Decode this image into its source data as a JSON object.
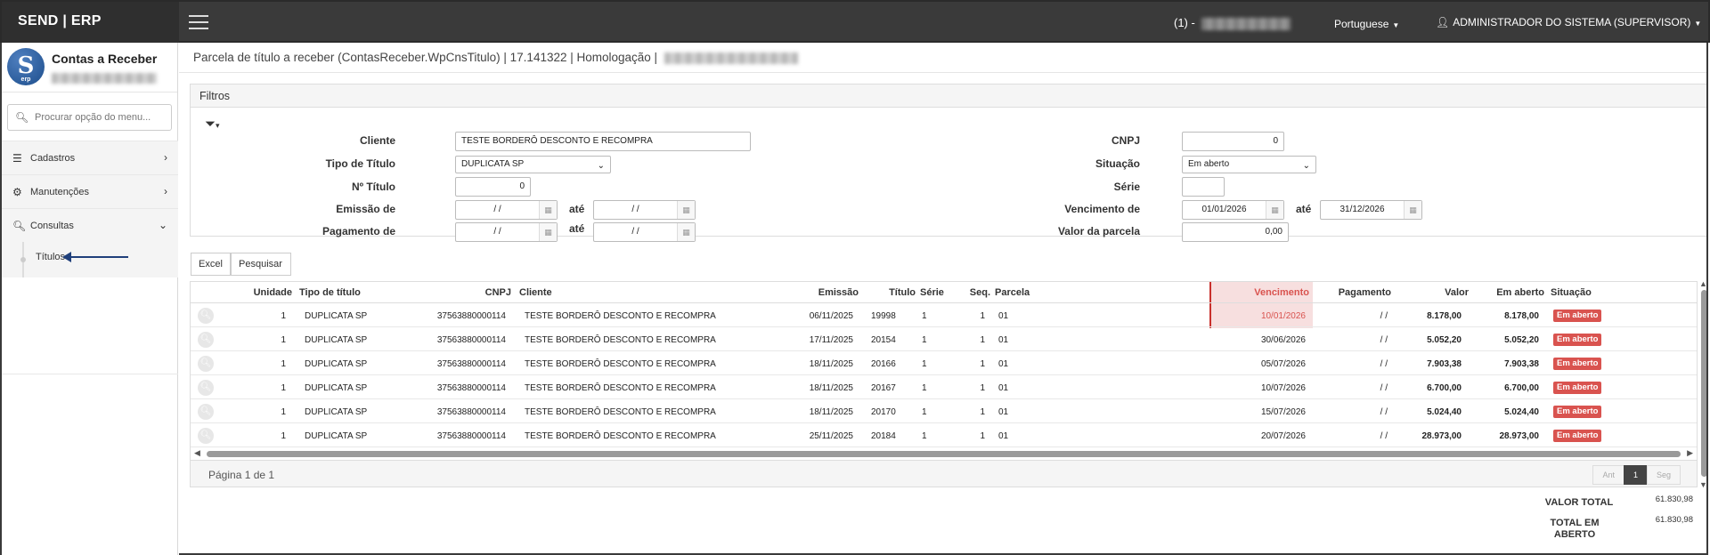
{
  "app": {
    "brand": "SEND | ERP"
  },
  "topbar": {
    "company_prefix": "(1) -",
    "language": "Portuguese",
    "user": "ADMINISTRADOR DO SISTEMA (SUPERVISOR)"
  },
  "sidebar": {
    "module_title": "Contas a Receber",
    "logo_letter": "S",
    "logo_sub": "erp",
    "search_placeholder": "Procurar opção do menu...",
    "items": [
      {
        "label": "Cadastros",
        "icon": "list-icon"
      },
      {
        "label": "Manutenções",
        "icon": "gears-icon"
      },
      {
        "label": "Consultas",
        "icon": "search-icon"
      }
    ],
    "submenu_item": "Títulos"
  },
  "breadcrumb": {
    "text": "Parcela de título a receber (ContasReceber.WpCnsTitulo) | 17.141322 | Homologação |"
  },
  "filters": {
    "title": "Filtros",
    "cliente": {
      "label": "Cliente",
      "value": "TESTE BORDERÔ DESCONTO E RECOMPRA"
    },
    "tipo_titulo": {
      "label": "Tipo de Título",
      "value": "DUPLICATA SP"
    },
    "numero_titulo": {
      "label": "Nº Título",
      "value": "0"
    },
    "emissao": {
      "label": "Emissão de",
      "from": "/ /",
      "ate": "até",
      "to": "/ /"
    },
    "pagamento": {
      "label": "Pagamento de",
      "from": "/ /",
      "ate": "até",
      "to": "/ /"
    },
    "cnpj": {
      "label": "CNPJ",
      "value": "0"
    },
    "situacao": {
      "label": "Situação",
      "value": "Em aberto"
    },
    "serie": {
      "label": "Série",
      "value": ""
    },
    "vencimento": {
      "label": "Vencimento de",
      "from": "01/01/2026",
      "ate": "até",
      "to": "31/12/2026"
    },
    "valor_parcela": {
      "label": "Valor da parcela",
      "value": "0,00"
    }
  },
  "buttons": {
    "excel": "Excel",
    "pesquisar": "Pesquisar"
  },
  "table": {
    "headers": {
      "unidade": "Unidade",
      "tipo": "Tipo de título",
      "cnpj": "CNPJ",
      "cliente": "Cliente",
      "emissao": "Emissão",
      "titulo": "Título",
      "serie": "Série",
      "seq": "Seq.",
      "parcela": "Parcela",
      "vencimento": "Vencimento",
      "pagamento": "Pagamento",
      "valor": "Valor",
      "em_aberto": "Em aberto",
      "situacao": "Situação"
    },
    "rows": [
      {
        "unidade": "1",
        "tipo": "DUPLICATA SP",
        "cnpj": "37563880000114",
        "cliente": "TESTE BORDERÔ DESCONTO E RECOMPRA",
        "emissao": "06/11/2025",
        "titulo": "19998",
        "serie": "1",
        "seq": "1",
        "parcela": "01",
        "vencimento": "10/01/2026",
        "pagamento": "/ /",
        "valor": "8.178,00",
        "em_aberto": "8.178,00",
        "situacao": "Em aberto"
      },
      {
        "unidade": "1",
        "tipo": "DUPLICATA SP",
        "cnpj": "37563880000114",
        "cliente": "TESTE BORDERÔ DESCONTO E RECOMPRA",
        "emissao": "17/11/2025",
        "titulo": "20154",
        "serie": "1",
        "seq": "1",
        "parcela": "01",
        "vencimento": "30/06/2026",
        "pagamento": "/ /",
        "valor": "5.052,20",
        "em_aberto": "5.052,20",
        "situacao": "Em aberto"
      },
      {
        "unidade": "1",
        "tipo": "DUPLICATA SP",
        "cnpj": "37563880000114",
        "cliente": "TESTE BORDERÔ DESCONTO E RECOMPRA",
        "emissao": "18/11/2025",
        "titulo": "20166",
        "serie": "1",
        "seq": "1",
        "parcela": "01",
        "vencimento": "05/07/2026",
        "pagamento": "/ /",
        "valor": "7.903,38",
        "em_aberto": "7.903,38",
        "situacao": "Em aberto"
      },
      {
        "unidade": "1",
        "tipo": "DUPLICATA SP",
        "cnpj": "37563880000114",
        "cliente": "TESTE BORDERÔ DESCONTO E RECOMPRA",
        "emissao": "18/11/2025",
        "titulo": "20167",
        "serie": "1",
        "seq": "1",
        "parcela": "01",
        "vencimento": "10/07/2026",
        "pagamento": "/ /",
        "valor": "6.700,00",
        "em_aberto": "6.700,00",
        "situacao": "Em aberto"
      },
      {
        "unidade": "1",
        "tipo": "DUPLICATA SP",
        "cnpj": "37563880000114",
        "cliente": "TESTE BORDERÔ DESCONTO E RECOMPRA",
        "emissao": "18/11/2025",
        "titulo": "20170",
        "serie": "1",
        "seq": "1",
        "parcela": "01",
        "vencimento": "15/07/2026",
        "pagamento": "/ /",
        "valor": "5.024,40",
        "em_aberto": "5.024,40",
        "situacao": "Em aberto"
      },
      {
        "unidade": "1",
        "tipo": "DUPLICATA SP",
        "cnpj": "37563880000114",
        "cliente": "TESTE BORDERÔ DESCONTO E RECOMPRA",
        "emissao": "25/11/2025",
        "titulo": "20184",
        "serie": "1",
        "seq": "1",
        "parcela": "01",
        "vencimento": "20/07/2026",
        "pagamento": "/ /",
        "valor": "28.973,00",
        "em_aberto": "28.973,00",
        "situacao": "Em aberto"
      }
    ]
  },
  "pagination": {
    "text": "Página 1 de 1",
    "prev": "Ant",
    "current": "1",
    "next": "Seg"
  },
  "totals": {
    "valor_total_label": "VALOR TOTAL",
    "valor_total": "61.830,98",
    "total_aberto_label": "TOTAL EM ABERTO",
    "total_aberto": "61.830,98"
  },
  "colors": {
    "topbar": "#3a3a3a",
    "danger": "#d9534f",
    "accent": "#1d4e8c"
  }
}
